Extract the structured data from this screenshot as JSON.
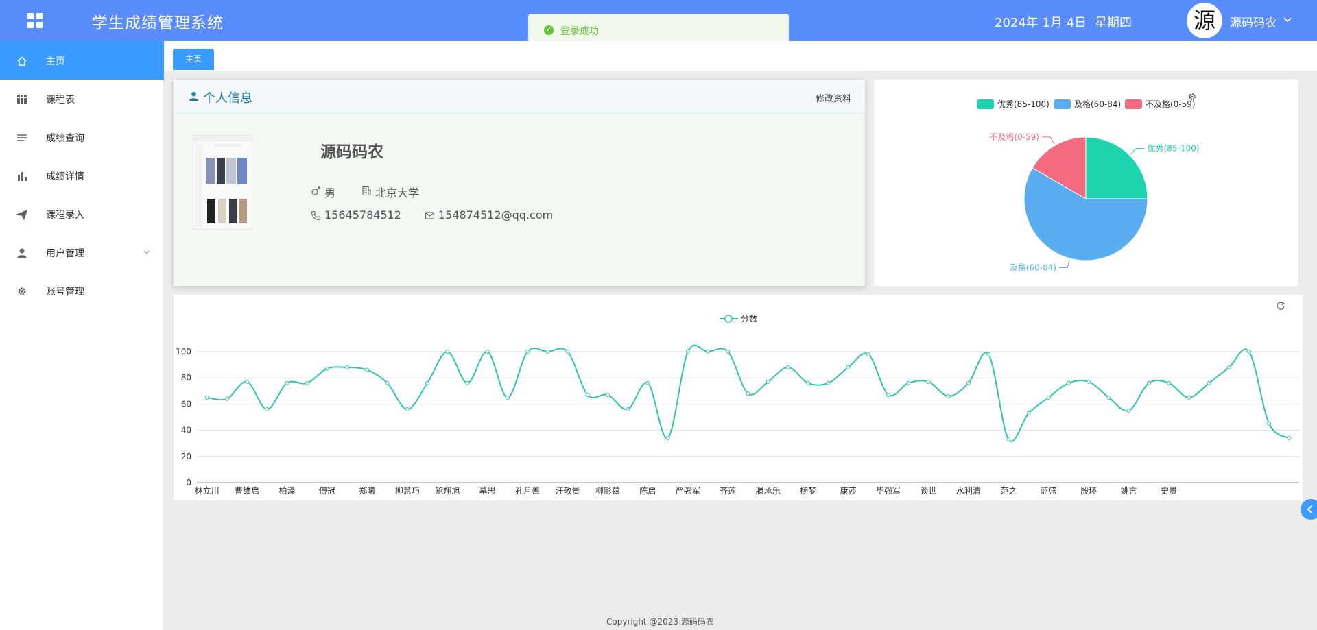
{
  "header": {
    "title": "学生成绩管理系统",
    "date": "2024年 1月 4日",
    "weekday": "星期四",
    "avatar_char": "源",
    "username": "源码码农"
  },
  "toast": {
    "message": "登录成功"
  },
  "sidebar": {
    "items": [
      {
        "label": "主页",
        "icon": "home-icon",
        "active": true
      },
      {
        "label": "课程表",
        "icon": "grid-icon"
      },
      {
        "label": "成绩查询",
        "icon": "list-icon"
      },
      {
        "label": "成绩详情",
        "icon": "bar-chart-icon"
      },
      {
        "label": "课程录入",
        "icon": "send-icon"
      },
      {
        "label": "用户管理",
        "icon": "user-icon",
        "has_submenu": true
      },
      {
        "label": "账号管理",
        "icon": "gear-icon"
      }
    ]
  },
  "tabs": [
    {
      "label": "主页"
    }
  ],
  "profile": {
    "card_title": "个人信息",
    "edit_label": "修改资料",
    "name": "源码码农",
    "gender": "男",
    "school": "北京大学",
    "phone": "15645784512",
    "email": "154874512@qq.com"
  },
  "footer": {
    "copyright": "Copyright @2023 源码码农"
  },
  "colors": {
    "header": "#598cfc",
    "active": "#3b9bff",
    "excellent": "#1ed4ae",
    "pass": "#5aaef0",
    "fail": "#f56c81",
    "line": "#2ec5a8"
  },
  "chart_data": [
    {
      "type": "pie",
      "legend_position": "top",
      "categories": [
        "优秀(85-100)",
        "及格(60-84)",
        "不及格(0-59)"
      ],
      "values": [
        9,
        21,
        6
      ],
      "colors": [
        "#1ed4ae",
        "#5aaef0",
        "#f56c81"
      ]
    },
    {
      "type": "line",
      "smooth": true,
      "legend_position": "top",
      "series": [
        {
          "name": "分数",
          "values": [
            65,
            64,
            77,
            56,
            76,
            76,
            87,
            88,
            86,
            76,
            56,
            76,
            100,
            76,
            100,
            65,
            100,
            100,
            100,
            67,
            67,
            56,
            76,
            34,
            100,
            100,
            100,
            68,
            77,
            88,
            76,
            76,
            88,
            98,
            67,
            76,
            77,
            66,
            76,
            98,
            33,
            53,
            65,
            76,
            77,
            65,
            55,
            76,
            76,
            65,
            76,
            88,
            100,
            45,
            34
          ]
        }
      ],
      "tick_labels": [
        "林立川",
        "曹维启",
        "柏泽",
        "傅冠",
        "郑曦",
        "柳慧巧",
        "鲍翔旭",
        "墓思",
        "孔月蓍",
        "汪敬贵",
        "柳影兹",
        "陈启",
        "严强军",
        "齐莲",
        "滕承乐",
        "杨梦",
        "康莎",
        "毕强军",
        "谈世",
        "水利清",
        "范之",
        "蓝盛",
        "殷环",
        "姚言",
        "史贵"
      ],
      "ylim": [
        0,
        100
      ],
      "yticks": [
        0,
        20,
        40,
        60,
        80,
        100
      ],
      "grid": true
    }
  ]
}
